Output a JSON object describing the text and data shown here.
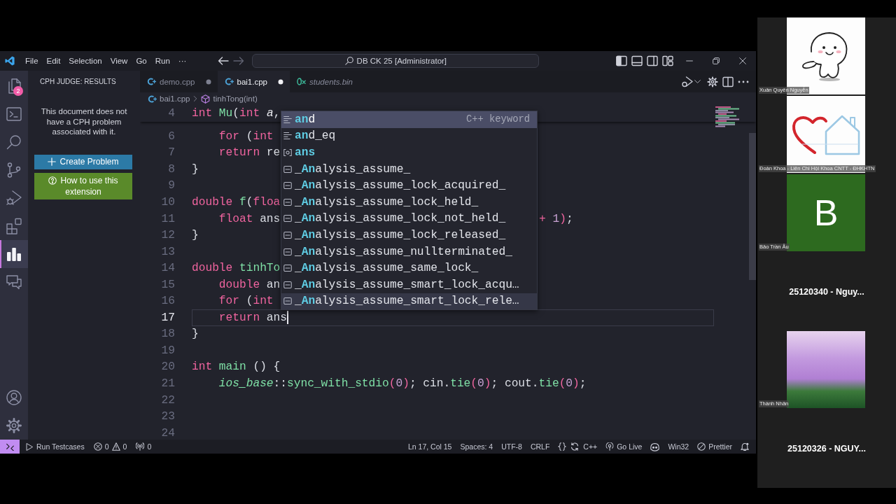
{
  "window": {
    "title": "DB CK 25 [Administrator]",
    "menu": [
      "File",
      "Edit",
      "Selection",
      "View",
      "Go",
      "Run",
      "···"
    ]
  },
  "activity_bar": {
    "top": [
      {
        "kind": "files",
        "badge": "2",
        "selected": false
      },
      {
        "kind": "terminal",
        "selected": false
      },
      {
        "kind": "search",
        "selected": false
      },
      {
        "kind": "source_control",
        "selected": false
      },
      {
        "kind": "run_debug",
        "selected": false
      },
      {
        "kind": "extensions",
        "selected": false
      },
      {
        "kind": "cph",
        "selected": true
      },
      {
        "kind": "feedback",
        "selected": false
      }
    ],
    "bottom": [
      {
        "kind": "account"
      },
      {
        "kind": "settings"
      }
    ]
  },
  "sidebar": {
    "title": "CPH JUDGE: RESULTS",
    "message": "This document does not have a CPH problem associated with it.",
    "buttons": [
      {
        "kind": "create",
        "label": "Create Problem"
      },
      {
        "kind": "help",
        "label": "How to use this extension"
      }
    ]
  },
  "editor": {
    "tabs": [
      {
        "label": "demo.cpp",
        "kind": "cpp",
        "selected": false,
        "modified": true,
        "preview": false
      },
      {
        "label": "bai1.cpp",
        "kind": "cpp",
        "selected": true,
        "modified": true,
        "preview": false
      },
      {
        "label": "students.bin",
        "kind": "binary",
        "selected": false,
        "modified": false,
        "preview": true
      }
    ],
    "breadcrumb": [
      {
        "kind": "file",
        "label": "bai1.cpp"
      },
      {
        "kind": "method",
        "label": "tinhTong(int)"
      }
    ],
    "sticky_line": {
      "number": "4",
      "indented": false,
      "tokens": [
        {
          "kind": "kw",
          "text": "int"
        },
        {
          "kind": "fn",
          "text": " Mu"
        },
        {
          "kind": "text",
          "text": "("
        },
        {
          "kind": "kw",
          "text": "int"
        },
        {
          "kind": "param",
          "text": " a"
        },
        {
          "kind": "text",
          "text": ","
        }
      ]
    },
    "lines": [
      {
        "number": "6",
        "current": false,
        "indented": true,
        "tokens": [
          {
            "kind": "kw",
            "text": "for"
          },
          {
            "kind": "text",
            "text": " ("
          },
          {
            "kind": "kw",
            "text": "int"
          }
        ]
      },
      {
        "number": "7",
        "current": false,
        "indented": true,
        "tokens": [
          {
            "kind": "kw",
            "text": "return"
          },
          {
            "kind": "text",
            "text": " re"
          }
        ]
      },
      {
        "number": "8",
        "current": false,
        "indented": false,
        "tokens": [
          {
            "kind": "text",
            "text": "}"
          }
        ]
      },
      {
        "number": "9",
        "current": false
      },
      {
        "number": "10",
        "current": false,
        "indented": false,
        "tokens": [
          {
            "kind": "kw",
            "text": "double"
          },
          {
            "kind": "fn",
            "text": " f"
          },
          {
            "kind": "text",
            "text": "("
          },
          {
            "kind": "kw",
            "text": "floa"
          }
        ]
      },
      {
        "number": "11",
        "current": false,
        "indented": true,
        "tokens": [
          {
            "kind": "kw",
            "text": "float"
          },
          {
            "kind": "text",
            "text": " ans"
          }
        ],
        "tail": [
          {
            "kind": "op",
            "text": "+"
          },
          {
            "kind": "num",
            "text": " 1"
          },
          {
            "kind": "op",
            "text": ")"
          },
          {
            "kind": "text",
            "text": ";"
          }
        ]
      },
      {
        "number": "12",
        "current": false,
        "indented": false,
        "tokens": [
          {
            "kind": "text",
            "text": "}"
          }
        ]
      },
      {
        "number": "13",
        "current": false
      },
      {
        "number": "14",
        "current": false,
        "indented": false,
        "tokens": [
          {
            "kind": "kw",
            "text": "double"
          },
          {
            "kind": "fn",
            "text": " tinhTo"
          }
        ]
      },
      {
        "number": "15",
        "current": false,
        "indented": true,
        "tokens": [
          {
            "kind": "kw",
            "text": "double"
          },
          {
            "kind": "text",
            "text": " an"
          }
        ]
      },
      {
        "number": "16",
        "current": false,
        "indented": true,
        "tokens": [
          {
            "kind": "kw",
            "text": "for"
          },
          {
            "kind": "text",
            "text": " ("
          },
          {
            "kind": "kw",
            "text": "int"
          }
        ]
      },
      {
        "number": "17",
        "current": true,
        "indented": true,
        "tokens": [
          {
            "kind": "kw",
            "text": "return"
          },
          {
            "kind": "text",
            "text": " ans"
          }
        ]
      },
      {
        "number": "18",
        "current": false,
        "indented": false,
        "tokens": [
          {
            "kind": "text",
            "text": "}"
          }
        ]
      },
      {
        "number": "19",
        "current": false
      },
      {
        "number": "20",
        "current": false,
        "indented": false,
        "tokens": [
          {
            "kind": "kw",
            "text": "int"
          },
          {
            "kind": "fn",
            "text": " main"
          },
          {
            "kind": "text",
            "text": " () {"
          }
        ]
      },
      {
        "number": "21",
        "current": false,
        "indented": true,
        "tokens": [
          {
            "kind": "type",
            "text": "ios_base"
          },
          {
            "kind": "text",
            "text": "::"
          },
          {
            "kind": "fn",
            "text": "sync_with_stdio"
          },
          {
            "kind": "op",
            "text": "("
          },
          {
            "kind": "num",
            "text": "0"
          },
          {
            "kind": "op",
            "text": ")"
          },
          {
            "kind": "text",
            "text": "; cin."
          },
          {
            "kind": "fn",
            "text": "tie"
          },
          {
            "kind": "op",
            "text": "("
          },
          {
            "kind": "num",
            "text": "0"
          },
          {
            "kind": "op",
            "text": ")"
          },
          {
            "kind": "text",
            "text": "; cout."
          },
          {
            "kind": "fn",
            "text": "tie"
          },
          {
            "kind": "op",
            "text": "("
          },
          {
            "kind": "num",
            "text": "0"
          },
          {
            "kind": "op",
            "text": ")"
          },
          {
            "kind": "text",
            "text": ";"
          }
        ]
      },
      {
        "number": "22",
        "current": false
      },
      {
        "number": "23",
        "current": false
      },
      {
        "number": "24",
        "current": false
      }
    ],
    "suggestions": [
      {
        "kind": "keyword",
        "label": "**an**d",
        "detail": "C++ keyword",
        "selected": true,
        "hovered": false
      },
      {
        "kind": "keyword",
        "label": "**an**d_eq",
        "selected": false,
        "hovered": false
      },
      {
        "kind": "variable",
        "label": "**ans**",
        "selected": false,
        "hovered": false
      },
      {
        "kind": "text",
        "label": "_**An**alysis_assume_",
        "selected": false,
        "hovered": false
      },
      {
        "kind": "text",
        "label": "_**An**alysis_assume_lock_acquired_",
        "selected": false,
        "hovered": false
      },
      {
        "kind": "text",
        "label": "_**An**alysis_assume_lock_held_",
        "selected": false,
        "hovered": false
      },
      {
        "kind": "text",
        "label": "_**An**alysis_assume_lock_not_held_",
        "selected": false,
        "hovered": false
      },
      {
        "kind": "text",
        "label": "_**An**alysis_assume_lock_released_",
        "selected": false,
        "hovered": false
      },
      {
        "kind": "text",
        "label": "_**An**alysis_assume_nullterminated_",
        "selected": false,
        "hovered": false
      },
      {
        "kind": "text",
        "label": "_**An**alysis_assume_same_lock_",
        "selected": false,
        "hovered": false
      },
      {
        "kind": "text",
        "label": "_**An**alysis_assume_smart_lock_acqu…",
        "selected": false,
        "hovered": false
      },
      {
        "kind": "text",
        "label": "_**An**alysis_assume_smart_lock_rele…",
        "selected": false,
        "hovered": true
      }
    ]
  },
  "status_bar": {
    "left": [
      {
        "kind": "remote"
      },
      {
        "kind": "run",
        "label": "Run Testcases"
      },
      {
        "kind": "problems",
        "errors": "0",
        "warnings": "0"
      },
      {
        "kind": "ports",
        "label": "0"
      }
    ],
    "right": [
      {
        "kind": "text",
        "label": "Ln 17, Col 15"
      },
      {
        "kind": "text",
        "label": "Spaces: 4"
      },
      {
        "kind": "text",
        "label": "UTF-8"
      },
      {
        "kind": "text",
        "label": "CRLF"
      },
      {
        "kind": "language",
        "label": "C++"
      },
      {
        "kind": "live",
        "label": "Go Live"
      },
      {
        "kind": "copilot"
      },
      {
        "kind": "text",
        "label": "Win32"
      },
      {
        "kind": "prettier",
        "label": "Prettier"
      },
      {
        "kind": "bell"
      }
    ]
  },
  "participants": [
    {
      "kind": "sticker",
      "name": "Xuân Quyên Nguyễn"
    },
    {
      "kind": "logo",
      "name": "Đoàn Khoa - Liên Chi Hội Khoa CNTT - ĐHKHTN"
    },
    {
      "kind": "avatar",
      "initial": "B",
      "name": "Bảo Trần Âu"
    },
    {
      "kind": "none",
      "name": "25120340 - Nguy..."
    },
    {
      "kind": "photo",
      "name": "Thành Nhân"
    },
    {
      "kind": "none",
      "name": "25120326 - NGUY..."
    }
  ]
}
